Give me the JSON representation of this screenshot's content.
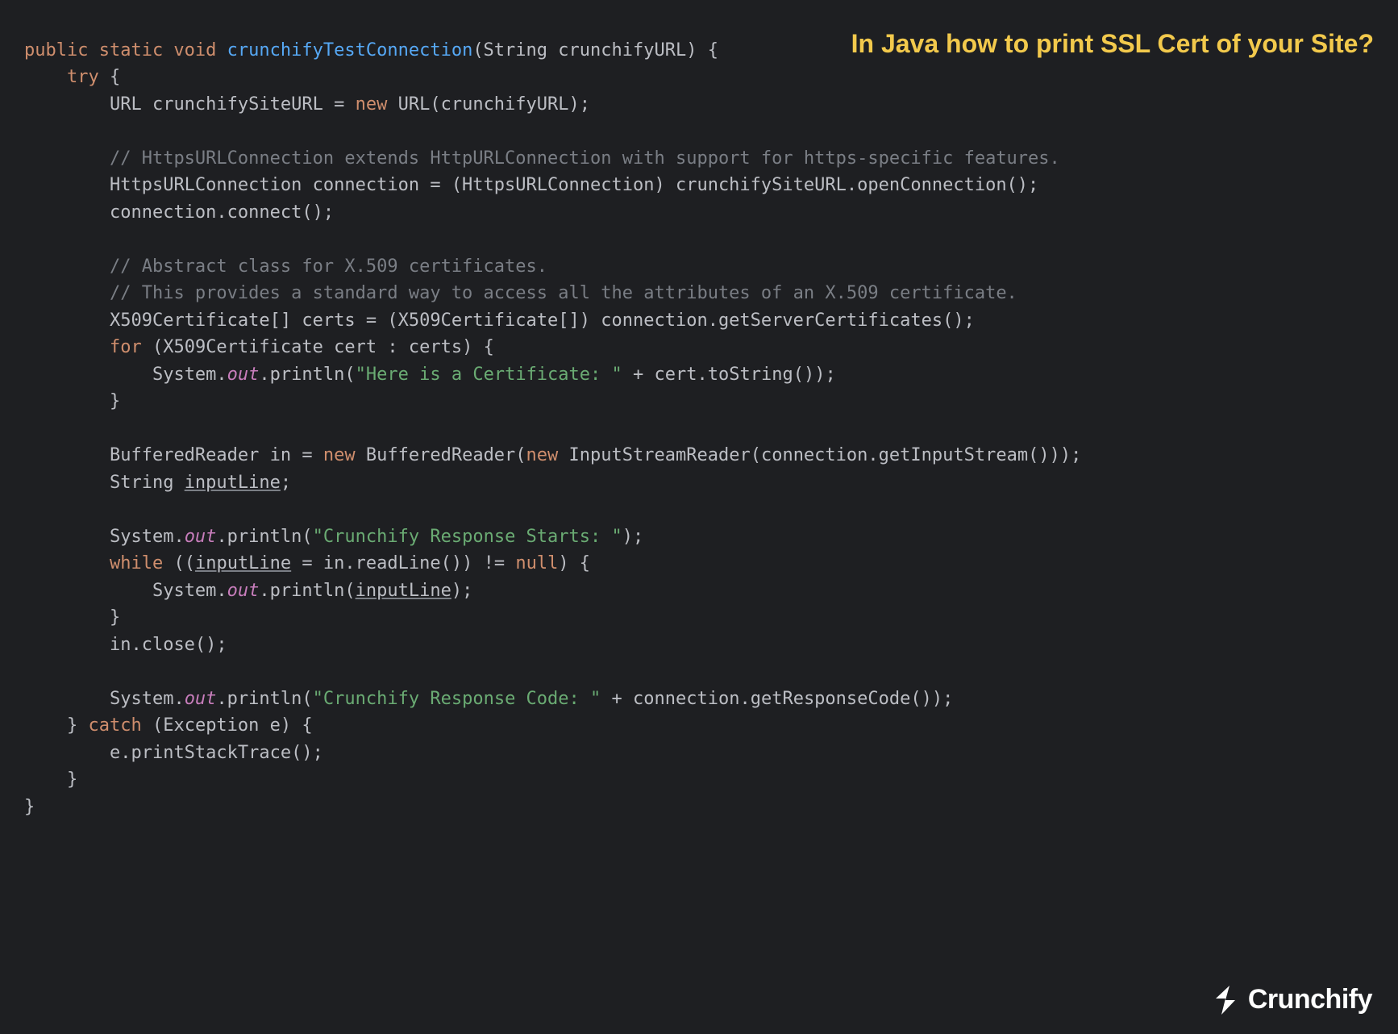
{
  "heading": "In Java how to print SSL Cert of your Site?",
  "logo_text": "Crunchify",
  "code": {
    "t1": "public static void",
    "t2": "crunchifyTestConnection",
    "t3": "(String crunchifyURL) {",
    "t4": "try",
    "t5": " {",
    "t6": "URL crunchifySiteURL = ",
    "t7": "new",
    "t8": " URL(crunchifyURL);",
    "c1": "// HttpsURLConnection extends HttpURLConnection with support for https-specific features.",
    "t9": "HttpsURLConnection connection = (HttpsURLConnection) crunchifySiteURL.openConnection();",
    "t10": "connection.connect();",
    "c2": "// Abstract class for X.509 certificates.",
    "c3": "// This provides a standard way to access all the attributes of an X.509 certificate.",
    "t11": "X509Certificate[] certs = (X509Certificate[]) connection.getServerCertificates();",
    "t12": "for",
    "t13": " (X509Certificate cert : certs) {",
    "t14": "System.",
    "out": "out",
    "t15": ".println(",
    "s1": "\"Here is a Certificate: \"",
    "t16": " + cert.toString());",
    "t17": "}",
    "t18": "BufferedReader in = ",
    "t19": " BufferedReader(",
    "t20": " InputStreamReader(connection.getInputStream()));",
    "t21": "String ",
    "inputLine": "inputLine",
    "t22": ";",
    "s2": "\"Crunchify Response Starts: \"",
    "t23": ");",
    "t24": "while",
    "t25": " ((",
    "t26": " = in.readLine()) != ",
    "null": "null",
    "t27": ") {",
    "t28": "in.close();",
    "s3": "\"Crunchify Response Code: \"",
    "t29": " + connection.getResponseCode());",
    "t30": "} ",
    "catch": "catch",
    "t31": " (Exception e) {",
    "t32": "e.printStackTrace();",
    "t33": "    }",
    "t34": "}"
  }
}
